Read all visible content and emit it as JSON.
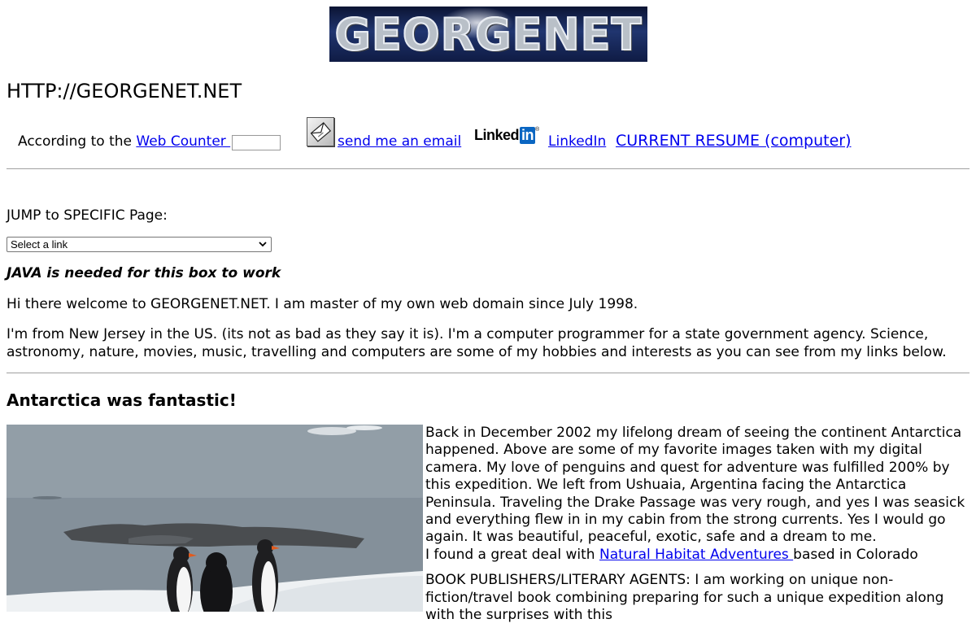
{
  "header": {
    "logo_text": "GEORGENET",
    "site_title": "HTTP://GEORGENET.NET"
  },
  "links_row": {
    "counter_prefix": "According to the ",
    "counter_link": "Web Counter ",
    "email_link": "send me an email",
    "linkedin_logo_text": "Linked",
    "linkedin_logo_in": "in",
    "linkedin_logo_reg": "®",
    "linkedin_link": "LinkedIn ",
    "resume_link": "CURRENT RESUME (computer)"
  },
  "jump": {
    "label": "JUMP to SPECIFIC Page:",
    "select_value": "Select a link",
    "java_note": "JAVA is needed for this box to work"
  },
  "intro": {
    "welcome": "Hi there welcome to GEORGENET.NET. I am master of my own web domain since July 1998.",
    "about": "I'm from New Jersey in the US. (its not as bad as they say it is). I'm a computer programmer for a state government agency. Science, astronomy, nature, movies, music, travelling and computers are some of my hobbies and interests as you can see from my links below."
  },
  "antarctica": {
    "heading": "Antarctica was fantastic!",
    "story": "Back in December 2002 my lifelong dream of seeing the continent Antarctica happened. Above are some of my favorite images taken with my digital camera. My love of penguins and quest for adventure was fulfilled 200% by this expedition. We left from Ushuaia, Argentina facing the Antarctica Peninsula. Traveling the Drake Passage was very rough, and yes I was seasick and everything flew in in my cabin from the strong currents. Yes I would go again. It was beautiful, peaceful, exotic, safe and a dream to me.",
    "deal_prefix": "I found a great deal with ",
    "deal_link": "Natural Habitat Adventures ",
    "deal_suffix": "based in Colorado",
    "publishers": "BOOK PUBLISHERS/LITERARY AGENTS: I am working on unique non-fiction/travel book combining preparing for such a unique expedition along with the surprises with this"
  },
  "colors": {
    "link": "#0000ee",
    "linkedin_blue": "#0a66c2",
    "logo_bg": "#20356f"
  },
  "icons": [
    "email-envelope-icon",
    "linkedin-logo",
    "chevron-down-icon"
  ]
}
